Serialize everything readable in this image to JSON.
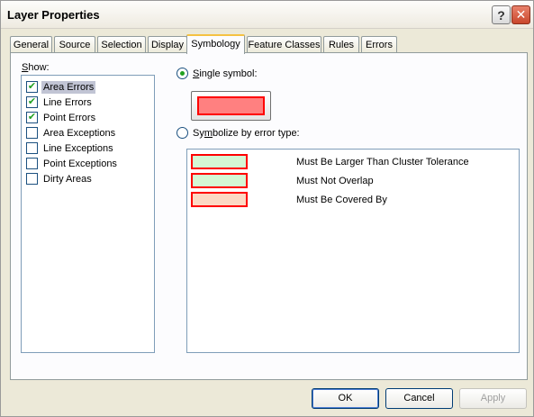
{
  "window": {
    "title": "Layer Properties",
    "help_label": "?",
    "close_label": "✕"
  },
  "tabs": [
    {
      "label": "General",
      "active": false
    },
    {
      "label": "Source",
      "active": false
    },
    {
      "label": "Selection",
      "active": false
    },
    {
      "label": "Display",
      "active": false
    },
    {
      "label": "Symbology",
      "active": true
    },
    {
      "label": "Feature Classes",
      "active": false
    },
    {
      "label": "Rules",
      "active": false
    },
    {
      "label": "Errors",
      "active": false
    }
  ],
  "show": {
    "label_prefix": "S",
    "label_rest": "how:",
    "items": [
      {
        "label": "Area Errors",
        "checked": true,
        "selected": true
      },
      {
        "label": "Line Errors",
        "checked": true,
        "selected": false
      },
      {
        "label": "Point Errors",
        "checked": true,
        "selected": false
      },
      {
        "label": "Area Exceptions",
        "checked": false,
        "selected": false
      },
      {
        "label": "Line Exceptions",
        "checked": false,
        "selected": false
      },
      {
        "label": "Point Exceptions",
        "checked": false,
        "selected": false
      },
      {
        "label": "Dirty Areas",
        "checked": false,
        "selected": false
      }
    ]
  },
  "single_symbol": {
    "label_prefix": "S",
    "label_rest": "ingle symbol:",
    "selected": true,
    "fill_color": "#ff8080",
    "outline_color": "#ff0000"
  },
  "by_error_type": {
    "label_pre": "Sy",
    "label_u": "m",
    "label_post": "bolize by error type:",
    "selected": false,
    "rows": [
      {
        "label": "Must Be Larger Than Cluster Tolerance",
        "fill_color": "#d4f7d4"
      },
      {
        "label": "Must Not Overlap",
        "fill_color": "#d4f7d4"
      },
      {
        "label": "Must Be Covered By",
        "fill_color": "#fcd9c4"
      }
    ]
  },
  "buttons": {
    "ok": "OK",
    "cancel": "Cancel",
    "apply": "Apply"
  },
  "colors": {
    "accent_tab": "#f5c242",
    "check": "#21a121",
    "outline": "#ff0000"
  }
}
